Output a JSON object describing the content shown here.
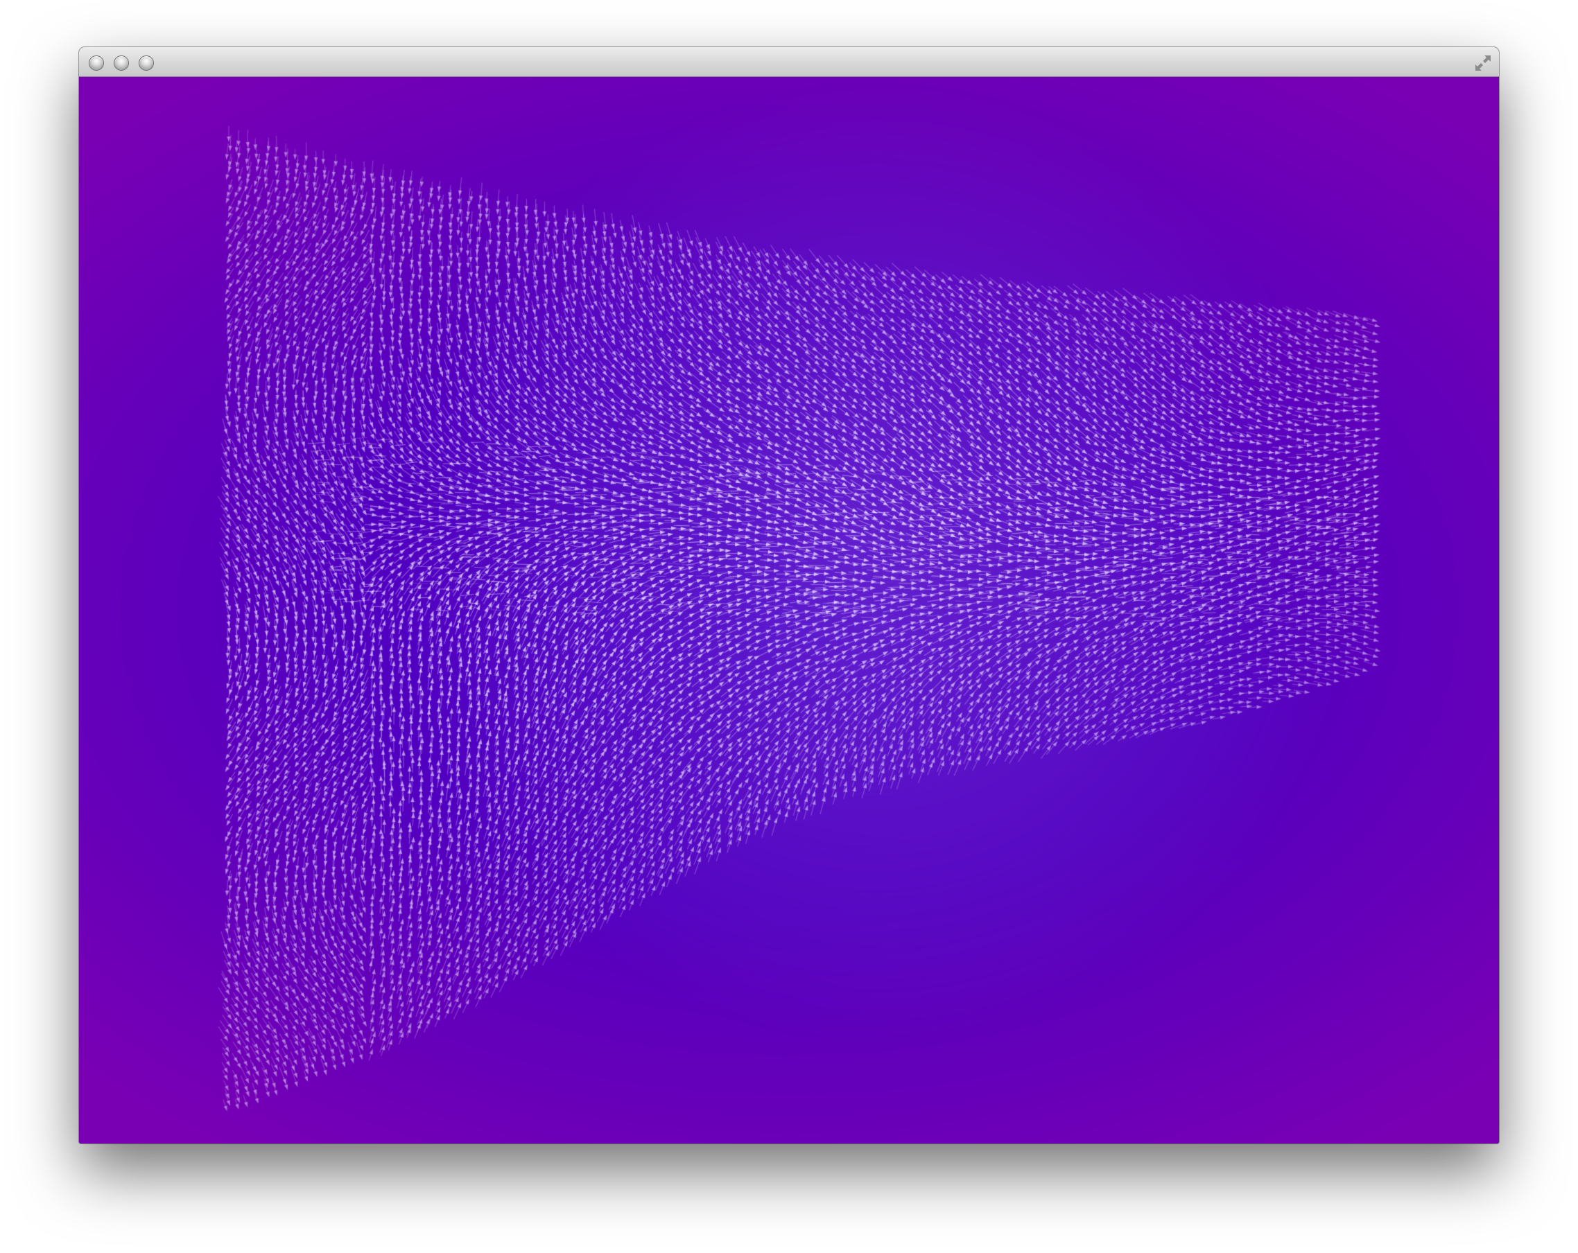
{
  "window": {
    "title": "",
    "buttons": {
      "close": "close-button",
      "minimize": "minimize-button",
      "zoom": "zoom-button",
      "fullscreen": "fullscreen-arrows-icon"
    }
  },
  "canvas": {
    "description_kind": "particle vector field visualization",
    "colors": {
      "background_center": "#4a00c4",
      "background_edge": "#7a00b4",
      "particle": "#e6d6ff",
      "highlight": "#ffffff"
    }
  }
}
